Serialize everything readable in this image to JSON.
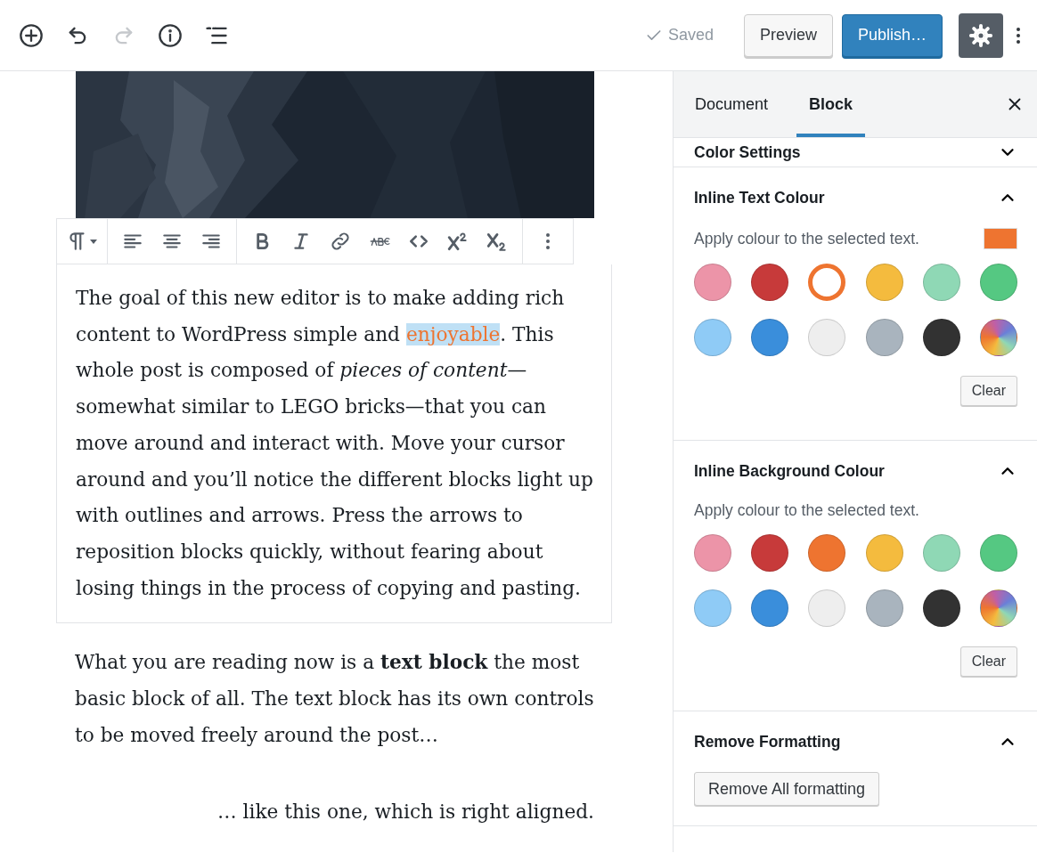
{
  "header": {
    "tools": [
      {
        "kind": "add",
        "disabled": false
      },
      {
        "kind": "undo",
        "disabled": false
      },
      {
        "kind": "redo",
        "disabled": true
      },
      {
        "kind": "info",
        "disabled": false
      },
      {
        "kind": "outline",
        "disabled": false
      }
    ],
    "saved": "Saved",
    "preview": "Preview",
    "publish": "Publish…",
    "settings_on": true
  },
  "editor": {
    "toolbar": [
      {
        "kind": "paragraph"
      },
      {
        "kind": "align-left"
      },
      {
        "kind": "align-center"
      },
      {
        "kind": "align-right"
      },
      {
        "kind": "bold"
      },
      {
        "kind": "italic"
      },
      {
        "kind": "link"
      },
      {
        "kind": "strike"
      },
      {
        "kind": "code"
      },
      {
        "kind": "sup"
      },
      {
        "kind": "sub"
      },
      {
        "kind": "more"
      }
    ],
    "selected_paragraph": [
      {
        "text": "The goal of this new editor is to make adding rich content to WordPress simple and ",
        "highlight": false
      },
      {
        "text": "enjoyable",
        "highlight": true
      },
      {
        "text": ". This whole post is composed of *pieces of content*—somewhat similar to LEGO bricks—that you can move around and interact with. Move your cursor around and you’ll notice the different blocks light up with outlines and arrows. Press the arrows to reposition blocks quickly, without fearing about losing things in the process of copying and pasting.",
        "highlight": false
      }
    ],
    "paragraphs": [
      {
        "text": "What you are reading now is a **text block** the most basic block of all. The text block has its own controls to be moved freely around the post…",
        "kind": "plain"
      },
      {
        "text": "… like this one, which is right aligned.",
        "kind": "right-aligned"
      }
    ]
  },
  "sidebar": {
    "tabs": [
      {
        "label": "Document",
        "selected": false
      },
      {
        "label": "Block",
        "selected": true
      }
    ],
    "panels": [
      {
        "kind": "collapsed",
        "title": "Color Settings",
        "expanded": false
      },
      {
        "kind": "palette",
        "title": "Inline Text Colour",
        "expanded": true,
        "help": "Apply colour to the selected text.",
        "current": {
          "color": "#ee7430"
        },
        "swatches": [
          {
            "color": "#ec94a8",
            "selected": false
          },
          {
            "color": "#c73a3a",
            "selected": false
          },
          {
            "color": "#ee7430",
            "selected": true
          },
          {
            "color": "#f4bb3e",
            "selected": false
          },
          {
            "color": "#8fd8b5",
            "selected": false
          },
          {
            "color": "#55c882",
            "selected": false
          },
          {
            "color": "#8fcbf6",
            "selected": false
          },
          {
            "color": "#3a8edb",
            "selected": false
          },
          {
            "color": "#eeeeee",
            "selected": false
          },
          {
            "color": "#a9b4be",
            "selected": false
          },
          {
            "color": "#323232",
            "selected": false
          },
          {
            "kind": "custom",
            "selected": false
          }
        ],
        "clear": "Clear"
      },
      {
        "kind": "palette",
        "title": "Inline Background Colour",
        "expanded": true,
        "help": "Apply colour to the selected text.",
        "swatches": [
          {
            "color": "#ec94a8",
            "selected": false
          },
          {
            "color": "#c73a3a",
            "selected": false
          },
          {
            "color": "#ee7430",
            "selected": false
          },
          {
            "color": "#f4bb3e",
            "selected": false
          },
          {
            "color": "#8fd8b5",
            "selected": false
          },
          {
            "color": "#55c882",
            "selected": false
          },
          {
            "color": "#8fcbf6",
            "selected": false
          },
          {
            "color": "#3a8edb",
            "selected": false
          },
          {
            "color": "#eeeeee",
            "selected": false
          },
          {
            "color": "#a9b4be",
            "selected": false
          },
          {
            "color": "#323232",
            "selected": false
          },
          {
            "kind": "custom",
            "selected": false
          }
        ],
        "clear": "Clear"
      },
      {
        "kind": "button",
        "title": "Remove Formatting",
        "expanded": true,
        "button": "Remove All formatting"
      }
    ]
  }
}
